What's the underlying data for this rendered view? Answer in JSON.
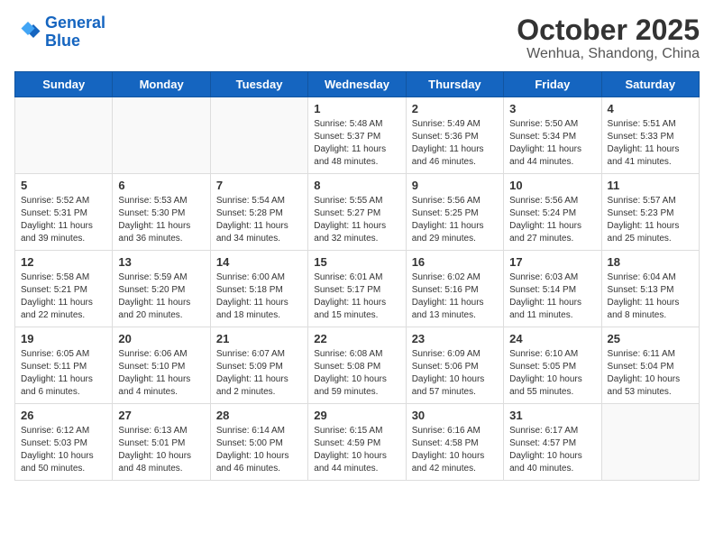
{
  "logo": {
    "line1": "General",
    "line2": "Blue"
  },
  "title": "October 2025",
  "subtitle": "Wenhua, Shandong, China",
  "weekdays": [
    "Sunday",
    "Monday",
    "Tuesday",
    "Wednesday",
    "Thursday",
    "Friday",
    "Saturday"
  ],
  "weeks": [
    [
      {
        "day": "",
        "info": ""
      },
      {
        "day": "",
        "info": ""
      },
      {
        "day": "",
        "info": ""
      },
      {
        "day": "1",
        "info": "Sunrise: 5:48 AM\nSunset: 5:37 PM\nDaylight: 11 hours\nand 48 minutes."
      },
      {
        "day": "2",
        "info": "Sunrise: 5:49 AM\nSunset: 5:36 PM\nDaylight: 11 hours\nand 46 minutes."
      },
      {
        "day": "3",
        "info": "Sunrise: 5:50 AM\nSunset: 5:34 PM\nDaylight: 11 hours\nand 44 minutes."
      },
      {
        "day": "4",
        "info": "Sunrise: 5:51 AM\nSunset: 5:33 PM\nDaylight: 11 hours\nand 41 minutes."
      }
    ],
    [
      {
        "day": "5",
        "info": "Sunrise: 5:52 AM\nSunset: 5:31 PM\nDaylight: 11 hours\nand 39 minutes."
      },
      {
        "day": "6",
        "info": "Sunrise: 5:53 AM\nSunset: 5:30 PM\nDaylight: 11 hours\nand 36 minutes."
      },
      {
        "day": "7",
        "info": "Sunrise: 5:54 AM\nSunset: 5:28 PM\nDaylight: 11 hours\nand 34 minutes."
      },
      {
        "day": "8",
        "info": "Sunrise: 5:55 AM\nSunset: 5:27 PM\nDaylight: 11 hours\nand 32 minutes."
      },
      {
        "day": "9",
        "info": "Sunrise: 5:56 AM\nSunset: 5:25 PM\nDaylight: 11 hours\nand 29 minutes."
      },
      {
        "day": "10",
        "info": "Sunrise: 5:56 AM\nSunset: 5:24 PM\nDaylight: 11 hours\nand 27 minutes."
      },
      {
        "day": "11",
        "info": "Sunrise: 5:57 AM\nSunset: 5:23 PM\nDaylight: 11 hours\nand 25 minutes."
      }
    ],
    [
      {
        "day": "12",
        "info": "Sunrise: 5:58 AM\nSunset: 5:21 PM\nDaylight: 11 hours\nand 22 minutes."
      },
      {
        "day": "13",
        "info": "Sunrise: 5:59 AM\nSunset: 5:20 PM\nDaylight: 11 hours\nand 20 minutes."
      },
      {
        "day": "14",
        "info": "Sunrise: 6:00 AM\nSunset: 5:18 PM\nDaylight: 11 hours\nand 18 minutes."
      },
      {
        "day": "15",
        "info": "Sunrise: 6:01 AM\nSunset: 5:17 PM\nDaylight: 11 hours\nand 15 minutes."
      },
      {
        "day": "16",
        "info": "Sunrise: 6:02 AM\nSunset: 5:16 PM\nDaylight: 11 hours\nand 13 minutes."
      },
      {
        "day": "17",
        "info": "Sunrise: 6:03 AM\nSunset: 5:14 PM\nDaylight: 11 hours\nand 11 minutes."
      },
      {
        "day": "18",
        "info": "Sunrise: 6:04 AM\nSunset: 5:13 PM\nDaylight: 11 hours\nand 8 minutes."
      }
    ],
    [
      {
        "day": "19",
        "info": "Sunrise: 6:05 AM\nSunset: 5:11 PM\nDaylight: 11 hours\nand 6 minutes."
      },
      {
        "day": "20",
        "info": "Sunrise: 6:06 AM\nSunset: 5:10 PM\nDaylight: 11 hours\nand 4 minutes."
      },
      {
        "day": "21",
        "info": "Sunrise: 6:07 AM\nSunset: 5:09 PM\nDaylight: 11 hours\nand 2 minutes."
      },
      {
        "day": "22",
        "info": "Sunrise: 6:08 AM\nSunset: 5:08 PM\nDaylight: 10 hours\nand 59 minutes."
      },
      {
        "day": "23",
        "info": "Sunrise: 6:09 AM\nSunset: 5:06 PM\nDaylight: 10 hours\nand 57 minutes."
      },
      {
        "day": "24",
        "info": "Sunrise: 6:10 AM\nSunset: 5:05 PM\nDaylight: 10 hours\nand 55 minutes."
      },
      {
        "day": "25",
        "info": "Sunrise: 6:11 AM\nSunset: 5:04 PM\nDaylight: 10 hours\nand 53 minutes."
      }
    ],
    [
      {
        "day": "26",
        "info": "Sunrise: 6:12 AM\nSunset: 5:03 PM\nDaylight: 10 hours\nand 50 minutes."
      },
      {
        "day": "27",
        "info": "Sunrise: 6:13 AM\nSunset: 5:01 PM\nDaylight: 10 hours\nand 48 minutes."
      },
      {
        "day": "28",
        "info": "Sunrise: 6:14 AM\nSunset: 5:00 PM\nDaylight: 10 hours\nand 46 minutes."
      },
      {
        "day": "29",
        "info": "Sunrise: 6:15 AM\nSunset: 4:59 PM\nDaylight: 10 hours\nand 44 minutes."
      },
      {
        "day": "30",
        "info": "Sunrise: 6:16 AM\nSunset: 4:58 PM\nDaylight: 10 hours\nand 42 minutes."
      },
      {
        "day": "31",
        "info": "Sunrise: 6:17 AM\nSunset: 4:57 PM\nDaylight: 10 hours\nand 40 minutes."
      },
      {
        "day": "",
        "info": ""
      }
    ]
  ]
}
